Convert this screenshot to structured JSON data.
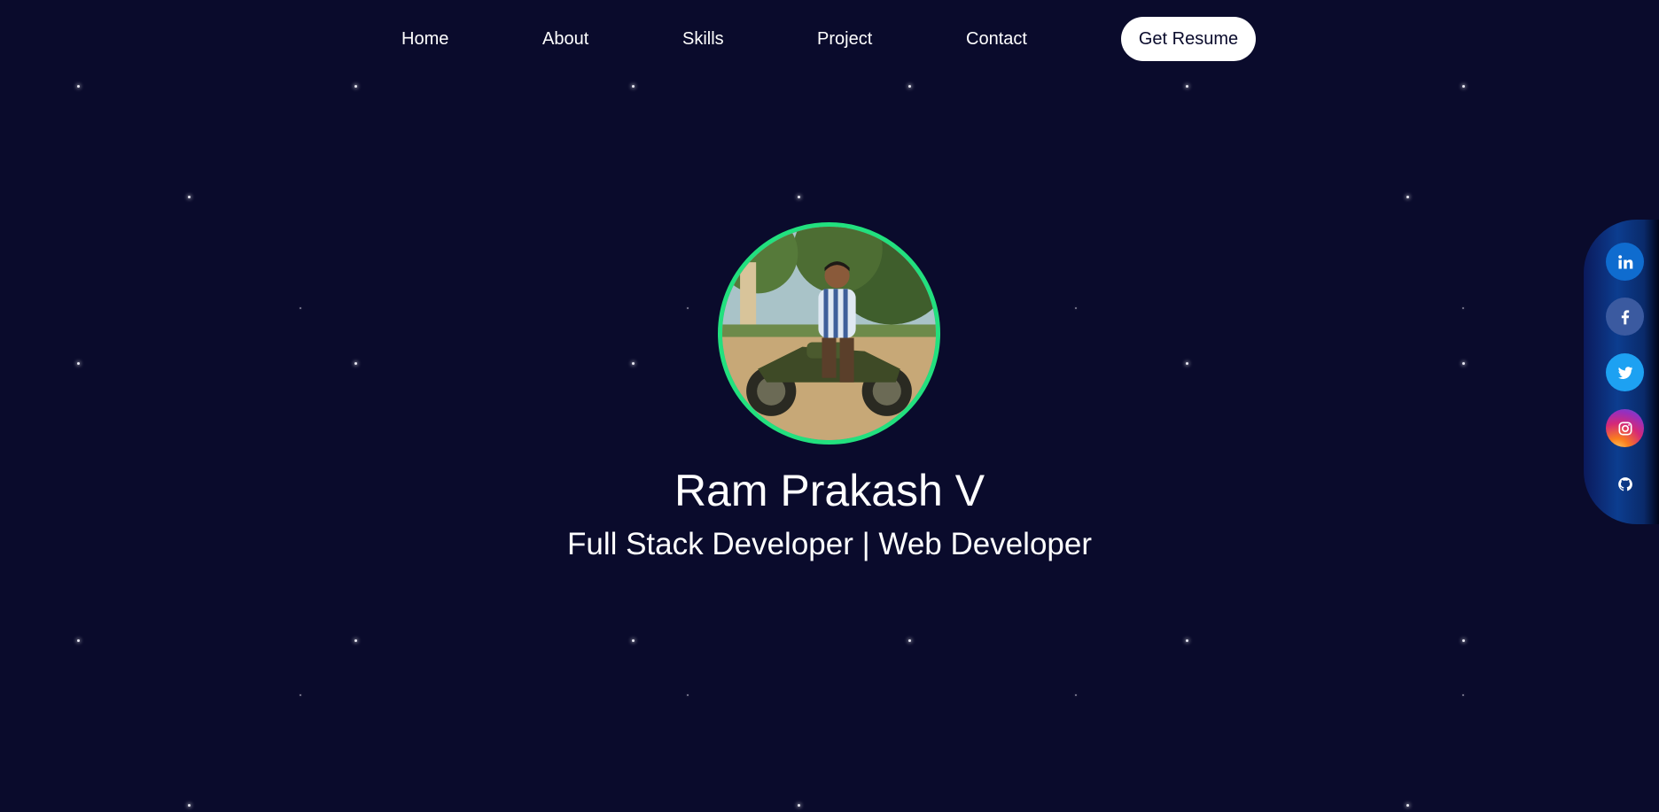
{
  "nav": {
    "items": [
      {
        "label": "Home"
      },
      {
        "label": "About"
      },
      {
        "label": "Skills"
      },
      {
        "label": "Project"
      },
      {
        "label": "Contact"
      }
    ],
    "resume_label": "Get Resume"
  },
  "hero": {
    "name": "Ram Prakash V",
    "subtitle": "Full Stack Developer | Web Developer",
    "avatar_icon": "profile-photo",
    "avatar_ring_color": "#22e07e"
  },
  "social": [
    {
      "icon": "linkedin-icon",
      "color": "#0f6ccf"
    },
    {
      "icon": "facebook-icon",
      "color": "#3b5aa0"
    },
    {
      "icon": "twitter-icon",
      "color": "#1da1f2"
    },
    {
      "icon": "instagram-icon",
      "color": "#d62976"
    },
    {
      "icon": "github-icon",
      "color": "#ffffff"
    }
  ],
  "theme": {
    "background": "#0a0b2c",
    "text": "#ffffff"
  }
}
